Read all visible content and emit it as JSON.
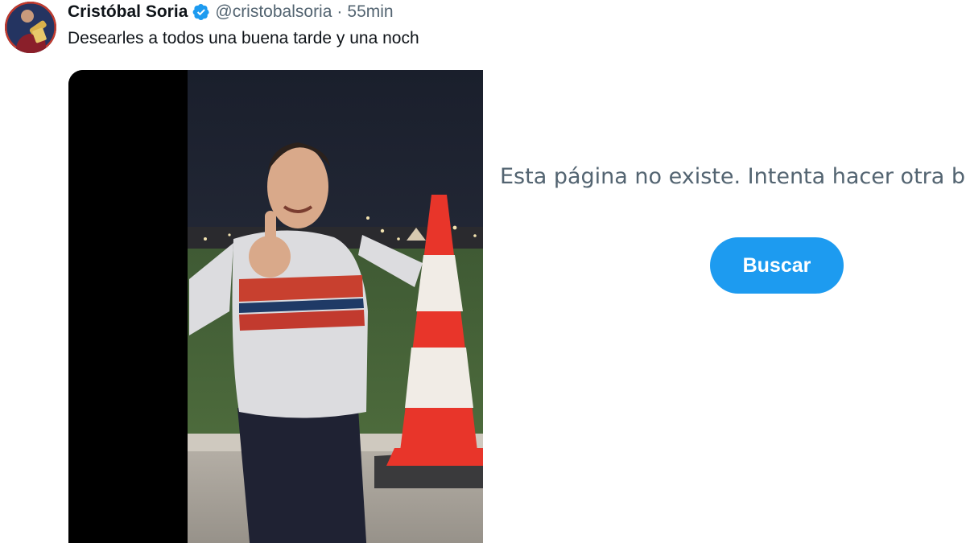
{
  "tweet": {
    "display_name": "Cristóbal Soria",
    "verified_icon": "verified-badge-icon",
    "handle": "@cristobalsoria",
    "separator": "·",
    "time": "55min",
    "text": "Desearles a todos una buena tarde y una noch",
    "media_description": "photo"
  },
  "not_found_page": {
    "message": "Esta página no existe. Intenta hacer otra bú",
    "button_label": "Buscar"
  },
  "colors": {
    "accent": "#1d9bf0",
    "text_primary": "#0f1419",
    "text_secondary": "#536471"
  }
}
